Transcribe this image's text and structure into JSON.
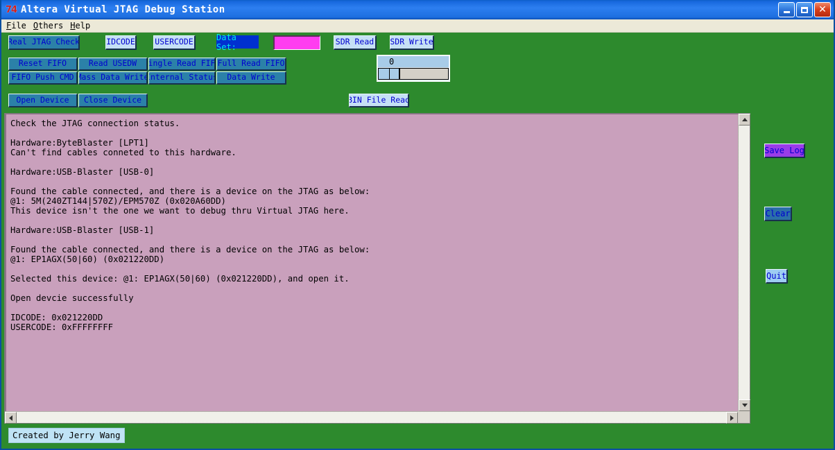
{
  "window": {
    "title": "Altera Virtual JTAG Debug Station",
    "app_icon": "jtag-app-icon",
    "minimize_label": "_",
    "maximize_label": "□",
    "close_label": "✕"
  },
  "menubar": {
    "items": [
      {
        "accel": "F",
        "rest": "ile"
      },
      {
        "accel": "O",
        "rest": "thers"
      },
      {
        "accel": "H",
        "rest": "elp"
      }
    ]
  },
  "toolbar": {
    "row1": [
      {
        "label": "Real JTAG Check",
        "style": "steel"
      },
      {
        "label": "IDCODE",
        "style": "light"
      },
      {
        "label": "USERCODE",
        "style": "light"
      },
      {
        "label": "SDR Read",
        "style": "light"
      },
      {
        "label": "SDR Write",
        "style": "light"
      }
    ],
    "data_set_label": "Data Set:",
    "data_set_value": "",
    "data_set_placeholder": "",
    "grid": [
      {
        "label": "Reset FIFO"
      },
      {
        "label": "Read USEDW"
      },
      {
        "label": "Single Read FIFO"
      },
      {
        "label": "Full Read FIFO"
      },
      {
        "label": "FIFO Push CMD"
      },
      {
        "label": "Mass Data Write"
      },
      {
        "label": "Internal Status"
      },
      {
        "label": "Data Write"
      }
    ],
    "device_buttons": [
      {
        "label": "Open Device"
      },
      {
        "label": "Close Device"
      }
    ],
    "bin_file_read_label": "BIN File Read",
    "slider": {
      "value": "0"
    }
  },
  "log": {
    "content": "Check the JTAG connection status.\n\nHardware:ByteBlaster [LPT1]\nCan't find cables conneted to this hardware.\n\nHardware:USB-Blaster [USB-0]\n\nFound the cable connected, and there is a device on the JTAG as below:\n@1: 5M(240ZT144|570Z)/EPM570Z (0x020A60DD)\nThis device isn't the one we want to debug thru Virtual JTAG here.\n\nHardware:USB-Blaster [USB-1]\n\nFound the cable connected, and there is a device on the JTAG as below:\n@1: EP1AGX(50|60) (0x021220DD)\n\nSelected this device: @1: EP1AGX(50|60) (0x021220DD), and open it.\n\nOpen devcie successfully\n\nIDCODE: 0x021220DD\nUSERCODE: 0xFFFFFFFF"
  },
  "side_buttons": [
    {
      "label": "Save Log",
      "style": "purple"
    },
    {
      "label": "Clear",
      "style": "darkblue"
    },
    {
      "label": "Quit",
      "style": "skyblue"
    }
  ],
  "statusbar": {
    "text": "Created by Jerry Wang"
  },
  "colors": {
    "background_green": "#2d8a2d",
    "titlebar_blue": "#1e6fe0",
    "log_background": "#c9a0bc",
    "accent_magenta": "#ff3df0",
    "button_steel": "#2b81a8",
    "button_light": "#c5e0f5",
    "button_text": "#0000d0"
  }
}
